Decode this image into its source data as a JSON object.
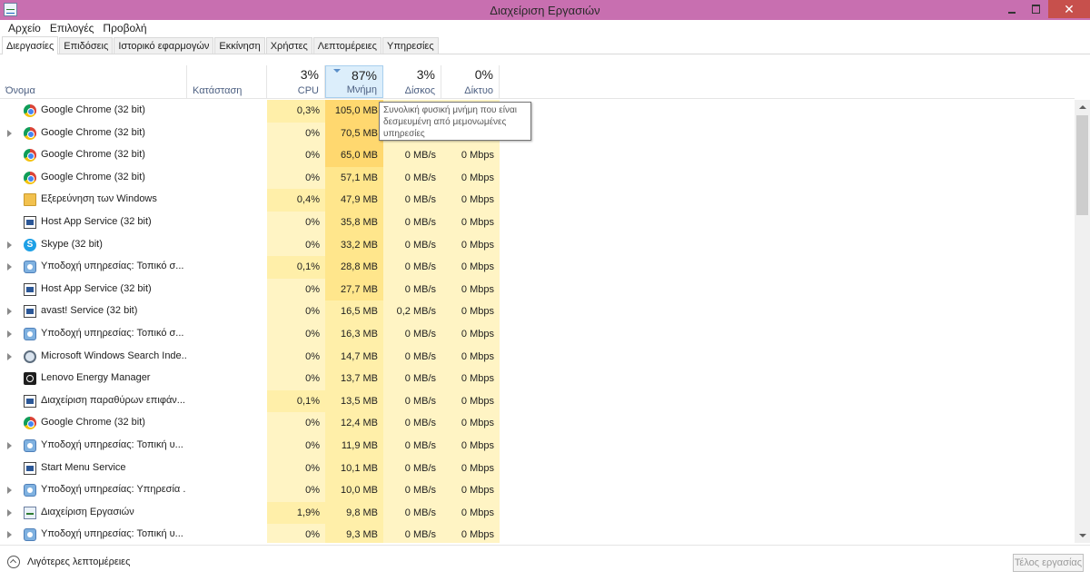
{
  "window": {
    "title": "Διαχείριση Εργασιών",
    "close_glyph": "✕"
  },
  "menu": [
    "Αρχείο",
    "Επιλογές",
    "Προβολή"
  ],
  "tabs": [
    "Διεργασίες",
    "Επιδόσεις",
    "Ιστορικό εφαρμογών",
    "Εκκίνηση",
    "Χρήστες",
    "Λεπτομέρειες",
    "Υπηρεσίες"
  ],
  "active_tab": "Διεργασίες",
  "columns": {
    "name": "Όνομα",
    "status": "Κατάσταση",
    "cpu": {
      "percent": "3%",
      "label": "CPU"
    },
    "memory": {
      "percent": "87%",
      "label": "Μνήμη"
    },
    "disk": {
      "percent": "3%",
      "label": "Δίσκος"
    },
    "network": {
      "percent": "0%",
      "label": "Δίκτυο"
    }
  },
  "sorted_column": "memory",
  "tooltip": "Συνολική φυσική μνήμη που είναι δεσμευμένη από μεμονωμένες υπηρεσίες",
  "processes": [
    {
      "name": "Google Chrome (32 bit)",
      "icon": "chrome-icon",
      "expandable": false,
      "cpu": "0,3%",
      "memory": "105,0 MB",
      "disk": "",
      "network": ""
    },
    {
      "name": "Google Chrome (32 bit)",
      "icon": "chrome-icon",
      "expandable": true,
      "cpu": "0%",
      "memory": "70,5 MB",
      "disk": "",
      "network": ""
    },
    {
      "name": "Google Chrome (32 bit)",
      "icon": "chrome-icon",
      "expandable": false,
      "cpu": "0%",
      "memory": "65,0 MB",
      "disk": "0 MB/s",
      "network": "0 Mbps"
    },
    {
      "name": "Google Chrome (32 bit)",
      "icon": "chrome-icon",
      "expandable": false,
      "cpu": "0%",
      "memory": "57,1 MB",
      "disk": "0 MB/s",
      "network": "0 Mbps"
    },
    {
      "name": "Εξερεύνηση των Windows",
      "icon": "explorer-icon",
      "expandable": false,
      "cpu": "0,4%",
      "memory": "47,9 MB",
      "disk": "0 MB/s",
      "network": "0 Mbps"
    },
    {
      "name": "Host App Service (32 bit)",
      "icon": "app-window-icon",
      "expandable": false,
      "cpu": "0%",
      "memory": "35,8 MB",
      "disk": "0 MB/s",
      "network": "0 Mbps"
    },
    {
      "name": "Skype (32 bit)",
      "icon": "skype-icon",
      "expandable": true,
      "cpu": "0%",
      "memory": "33,2 MB",
      "disk": "0 MB/s",
      "network": "0 Mbps"
    },
    {
      "name": "Υποδοχή υπηρεσίας: Τοπικό σ...",
      "icon": "service-gear-icon",
      "expandable": true,
      "cpu": "0,1%",
      "memory": "28,8 MB",
      "disk": "0 MB/s",
      "network": "0 Mbps"
    },
    {
      "name": "Host App Service (32 bit)",
      "icon": "app-window-icon",
      "expandable": false,
      "cpu": "0%",
      "memory": "27,7 MB",
      "disk": "0 MB/s",
      "network": "0 Mbps"
    },
    {
      "name": "avast! Service (32 bit)",
      "icon": "app-window-icon",
      "expandable": true,
      "cpu": "0%",
      "memory": "16,5 MB",
      "disk": "0,2 MB/s",
      "network": "0 Mbps"
    },
    {
      "name": "Υποδοχή υπηρεσίας: Τοπικό σ...",
      "icon": "service-gear-icon",
      "expandable": true,
      "cpu": "0%",
      "memory": "16,3 MB",
      "disk": "0 MB/s",
      "network": "0 Mbps"
    },
    {
      "name": "Microsoft Windows Search Inde...",
      "icon": "search-indexer-icon",
      "expandable": true,
      "cpu": "0%",
      "memory": "14,7 MB",
      "disk": "0 MB/s",
      "network": "0 Mbps"
    },
    {
      "name": "Lenovo Energy Manager",
      "icon": "lenovo-energy-icon",
      "expandable": false,
      "cpu": "0%",
      "memory": "13,7 MB",
      "disk": "0 MB/s",
      "network": "0 Mbps"
    },
    {
      "name": "Διαχείριση παραθύρων επιφάν...",
      "icon": "app-window-icon",
      "expandable": false,
      "cpu": "0,1%",
      "memory": "13,5 MB",
      "disk": "0 MB/s",
      "network": "0 Mbps"
    },
    {
      "name": "Google Chrome (32 bit)",
      "icon": "chrome-icon",
      "expandable": false,
      "cpu": "0%",
      "memory": "12,4 MB",
      "disk": "0 MB/s",
      "network": "0 Mbps"
    },
    {
      "name": "Υποδοχή υπηρεσίας: Τοπική υ...",
      "icon": "service-gear-icon",
      "expandable": true,
      "cpu": "0%",
      "memory": "11,9 MB",
      "disk": "0 MB/s",
      "network": "0 Mbps"
    },
    {
      "name": "Start Menu Service",
      "icon": "app-window-icon",
      "expandable": false,
      "cpu": "0%",
      "memory": "10,1 MB",
      "disk": "0 MB/s",
      "network": "0 Mbps"
    },
    {
      "name": "Υποδοχή υπηρεσίας: Υπηρεσία ...",
      "icon": "service-gear-icon",
      "expandable": true,
      "cpu": "0%",
      "memory": "10,0 MB",
      "disk": "0 MB/s",
      "network": "0 Mbps"
    },
    {
      "name": "Διαχείριση Εργασιών",
      "icon": "task-manager-icon",
      "expandable": true,
      "cpu": "1,9%",
      "memory": "9,8 MB",
      "disk": "0 MB/s",
      "network": "0 Mbps"
    },
    {
      "name": "Υποδοχή υπηρεσίας: Τοπική υ...",
      "icon": "service-gear-icon",
      "expandable": true,
      "cpu": "0%",
      "memory": "9,3 MB",
      "disk": "0 MB/s",
      "network": "0 Mbps"
    }
  ],
  "footer": {
    "less_details": "Λιγότερες λεπτομέρειες",
    "end_task": "Τέλος εργασίας"
  },
  "colors": {
    "titlebar": "#c86fb0",
    "close_button": "#c7504c",
    "heat_light": "#fff4c4",
    "heat_strong": "#ffd86f",
    "sorted_header": "#dceefb"
  }
}
